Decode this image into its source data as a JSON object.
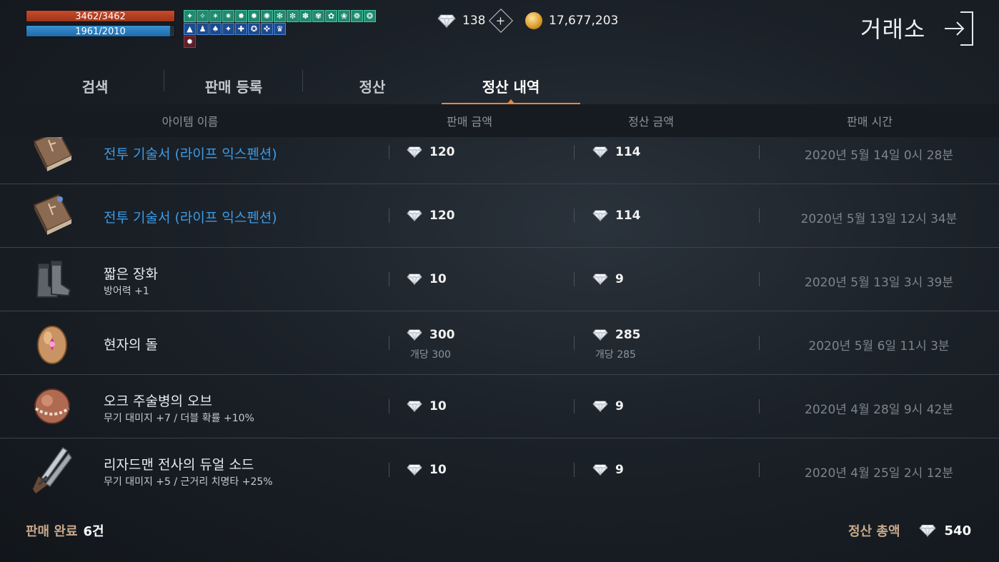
{
  "player": {
    "hp": "3462/3462",
    "mp": "1961/2010"
  },
  "buffs": {
    "row1": [
      "✦",
      "✧",
      "✶",
      "✷",
      "✸",
      "✹",
      "✺",
      "✻",
      "✼",
      "✽",
      "✾",
      "✿",
      "❀",
      "❁",
      "❂"
    ],
    "row2": [
      "▲",
      "♟",
      "♠",
      "✦",
      "✚",
      "✪",
      "✜",
      "♛"
    ],
    "row3": [
      "✹"
    ]
  },
  "currency": {
    "diamond": "138",
    "gold": "17,677,203",
    "plus_symbol": "+"
  },
  "window": {
    "title": "거래소"
  },
  "tabs": [
    "검색",
    "판매 등록",
    "정산",
    "정산 내역"
  ],
  "columns": {
    "name": "아이템 이름",
    "sale": "판매 금액",
    "settle": "정산 금액",
    "time": "판매 시간"
  },
  "rows": [
    {
      "name": "전투 기술서 (라이프 익스펜션)",
      "sub": "",
      "sale": "120",
      "sale_sub": "",
      "settle": "114",
      "settle_sub": "",
      "time": "2020년 5월 14일 0시 28분",
      "highlight": true,
      "icon": "skill-book-icon"
    },
    {
      "name": "전투 기술서 (라이프 익스펜션)",
      "sub": "",
      "sale": "120",
      "sale_sub": "",
      "settle": "114",
      "settle_sub": "",
      "time": "2020년 5월 13일 12시 34분",
      "highlight": true,
      "icon": "skill-book-icon"
    },
    {
      "name": "짧은 장화",
      "sub": "방어력 +1",
      "sale": "10",
      "sale_sub": "",
      "settle": "9",
      "settle_sub": "",
      "time": "2020년 5월 13일 3시 39분",
      "highlight": false,
      "icon": "boots-icon"
    },
    {
      "name": "현자의 돌",
      "sub": "",
      "sale": "300",
      "sale_sub": "개당 300",
      "settle": "285",
      "settle_sub": "개당 285",
      "time": "2020년 5월 6일 11시 3분",
      "highlight": false,
      "icon": "sage-stone-icon"
    },
    {
      "name": "오크 주술병의 오브",
      "sub": "무기 대미지 +7 / 더블 확률 +10%",
      "sale": "10",
      "sale_sub": "",
      "settle": "9",
      "settle_sub": "",
      "time": "2020년 4월 28일 9시 42분",
      "highlight": false,
      "icon": "orb-icon"
    },
    {
      "name": "리자드맨 전사의 듀얼 소드",
      "sub": "무기 대미지 +5 / 근거리 치명타 +25%",
      "sale": "10",
      "sale_sub": "",
      "settle": "9",
      "settle_sub": "",
      "time": "2020년 4월 25일 2시 12분",
      "highlight": false,
      "icon": "dual-sword-icon"
    }
  ],
  "footer": {
    "completed_label": "판매 완료",
    "completed_value": "6건",
    "total_label": "정산 총액",
    "total_value": "540"
  },
  "colors": {
    "accent": "#e8883a",
    "highlight_text": "#3d9be6",
    "hp": "#c94a2a",
    "mp": "#3a8fd0"
  }
}
